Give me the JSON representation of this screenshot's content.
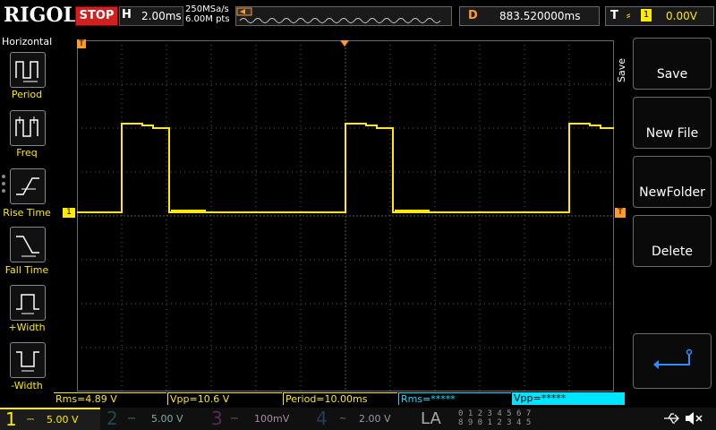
{
  "top": {
    "brand": "RIGOL",
    "run_state": "STOP",
    "horizontal_label": "H",
    "timebase": "2.00ms",
    "sample_rate": "250MSa/s",
    "memory_depth": "6.00M pts",
    "delay_label": "D",
    "delay_value": "883.520000ms",
    "trigger_label": "T",
    "trigger_channel": "1",
    "trigger_level": "0.00V"
  },
  "left_menu": {
    "title": "Horizontal",
    "items": [
      {
        "label": "Period",
        "icon": "period-icon"
      },
      {
        "label": "Freq",
        "icon": "frequency-icon"
      },
      {
        "label": "Rise Time",
        "icon": "rise-time-icon"
      },
      {
        "label": "Fall Time",
        "icon": "fall-time-icon"
      },
      {
        "label": "+Width",
        "icon": "positive-width-icon"
      },
      {
        "label": "-Width",
        "icon": "negative-width-icon"
      }
    ]
  },
  "markers": {
    "trigger_pos_left": "T",
    "trigger_level_right": "T",
    "channel1": "1"
  },
  "right_menu": {
    "tab": "Save",
    "buttons": [
      "Save",
      "New File",
      "NewFolder",
      "Delete"
    ]
  },
  "measurements": [
    {
      "label": "Rms=4.89 V",
      "color": "#ffea00"
    },
    {
      "label": "Vpp=10.6 V",
      "color": "#ffea00"
    },
    {
      "label": "Period=10.00ms",
      "color": "#ffea00"
    },
    {
      "label": "Rms=*****",
      "color": "#00e5ff"
    },
    {
      "label": "Vpp=*****",
      "color": "#00e5ff"
    }
  ],
  "channels": [
    {
      "num": "1",
      "scale": "5.00 V",
      "color": "#ffea00",
      "active": true
    },
    {
      "num": "2",
      "scale": "5.00 V",
      "color": "#00e5ff",
      "active": false
    },
    {
      "num": "3",
      "scale": "100mV",
      "color": "#ff33ff",
      "active": false
    },
    {
      "num": "4",
      "scale": "2.00 V",
      "color": "#3399ff",
      "active": false
    }
  ],
  "la": {
    "label": "LA",
    "digits_row1": "0 1 2 3  4 5 6 7",
    "digits_row2": "8 9 0 1  2 3 4 5"
  },
  "colors": {
    "ch1": "#ffea00",
    "grid": "#5a5a5a",
    "accent": "#ff9a2a"
  },
  "status_icons": [
    "usb-icon",
    "mute-icon"
  ]
}
